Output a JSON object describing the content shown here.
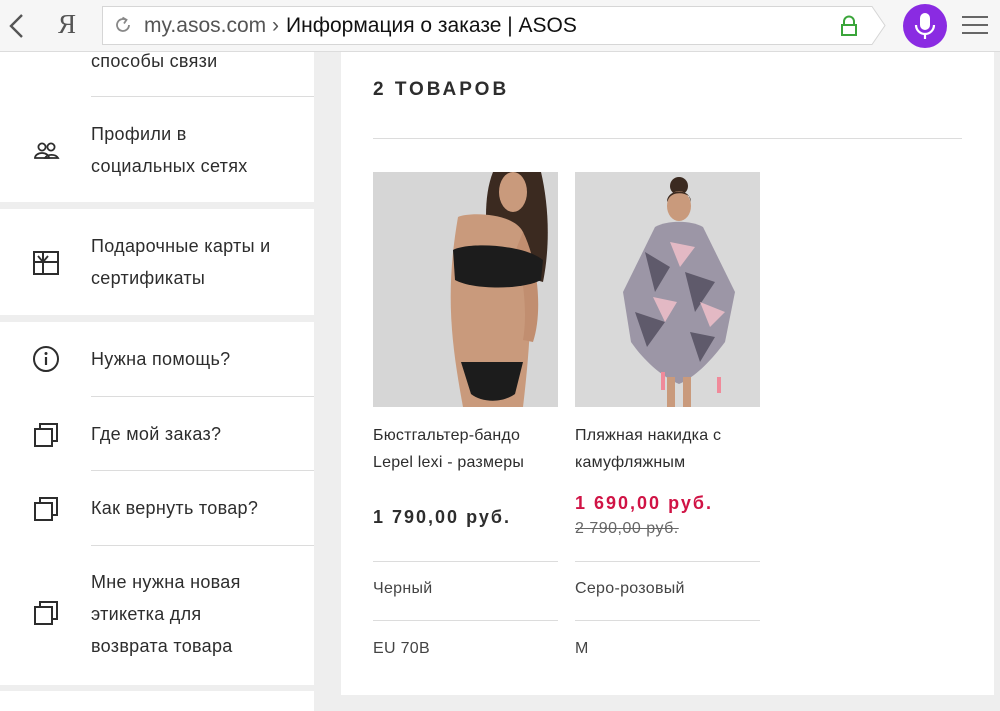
{
  "browser": {
    "yandex_letter": "Я",
    "url_domain": "my.asos.com",
    "url_separator": "›",
    "page_title": "Информация о заказе | ASOS",
    "accent_color": "#8a2be2",
    "lock_color": "#3aa53a"
  },
  "sidebar": {
    "items": [
      {
        "label": "способы связи",
        "icon": "none"
      },
      {
        "label": "Профили в\nсоциальных сетях",
        "icon": "people-icon"
      },
      {
        "label": "Подарочные карты и\nсертификаты",
        "icon": "gift-card-icon"
      },
      {
        "label": "Нужна помощь?",
        "icon": "info-icon"
      },
      {
        "label": "Где мой заказ?",
        "icon": "copy-icon"
      },
      {
        "label": "Как вернуть товар?",
        "icon": "copy-icon"
      },
      {
        "label": "Мне нужна новая\nэтикетка для\nвозврата товара",
        "icon": "copy-icon"
      }
    ]
  },
  "order": {
    "heading": "2 ТОВАРОВ",
    "products": [
      {
        "name": "Бюстгальтер-бандо Lepel lexi - размеры",
        "price": "1 790,00 руб.",
        "color": "Черный",
        "size": "EU 70B"
      },
      {
        "name": "Пляжная накидка с камуфляжным",
        "price": "1 690,00 руб.",
        "old_price": "2 790,00 руб.",
        "color": "Серо-розовый",
        "size": "M",
        "sale_color": "#d01345"
      }
    ]
  }
}
